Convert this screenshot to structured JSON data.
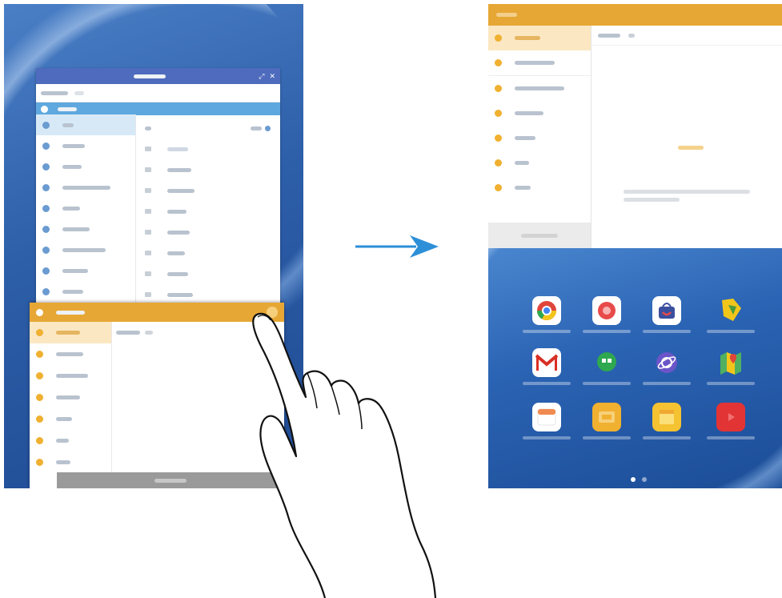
{
  "left_screen": {
    "popup_window": {
      "title": "",
      "subheader": "",
      "left_items": [
        "",
        "",
        "",
        "",
        "",
        "",
        "",
        "",
        "",
        ""
      ],
      "right_items": [
        "",
        "",
        "",
        "",
        "",
        "",
        "",
        "",
        ""
      ]
    },
    "bottom_window": {
      "title": "",
      "folders": [
        "",
        "",
        "",
        "",
        "",
        "",
        ""
      ],
      "footer_button": ""
    }
  },
  "right_screen": {
    "email_window": {
      "title": "",
      "folders": [
        "",
        "",
        "",
        "",
        "",
        "",
        ""
      ],
      "empty_message": "",
      "footer_button": ""
    },
    "home_apps": [
      {
        "name": "",
        "icon": "chrome-icon",
        "color": "#e0453a"
      },
      {
        "name": "",
        "icon": "camera-icon",
        "color": "#e84a4a"
      },
      {
        "name": "",
        "icon": "galaxy-apps-icon",
        "color": "#ffffff"
      },
      {
        "name": "",
        "icon": "gallery-icon",
        "color": "#f2c51b"
      },
      {
        "name": "",
        "icon": "gmail-icon",
        "color": "#ffffff"
      },
      {
        "name": "",
        "icon": "hangouts-icon",
        "color": "#2fa84f"
      },
      {
        "name": "",
        "icon": "internet-icon",
        "color": "#6a55c8"
      },
      {
        "name": "",
        "icon": "maps-icon",
        "color": "#4fb060"
      },
      {
        "name": "",
        "icon": "calendar-icon",
        "color": "#ffffff"
      },
      {
        "name": "",
        "icon": "smart-manager-icon",
        "color": "#f0b030"
      },
      {
        "name": "",
        "icon": "memo-icon",
        "color": "#f5c232"
      },
      {
        "name": "",
        "icon": "youtube-icon",
        "color": "#e23434"
      }
    ],
    "page_indicator": {
      "count": 2,
      "active": 1
    }
  },
  "colors": {
    "accent_orange": "#e7a735",
    "accent_blue": "#4e6bbd",
    "arrow_blue": "#2d8fd8"
  }
}
